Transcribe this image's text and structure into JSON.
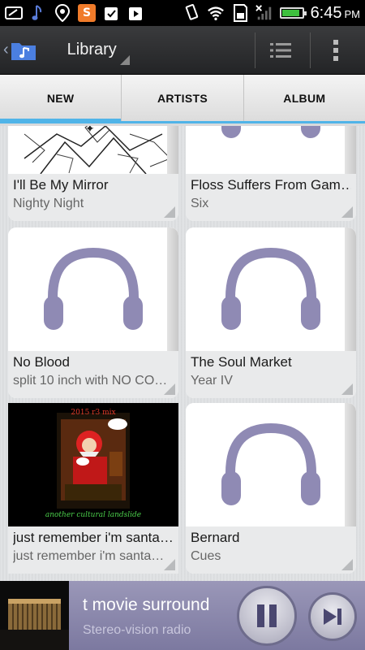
{
  "status_bar": {
    "time": "6:45",
    "ampm": "PM",
    "battery_level": 0.9,
    "left_icons": [
      "tablet-icon",
      "music-note-icon",
      "location-pin-icon",
      "s-app-icon",
      "clipboard-check-icon",
      "video-play-icon"
    ],
    "right_icons": [
      "vibrate-icon",
      "wifi-icon",
      "sd-card-icon",
      "no-signal-icon",
      "battery-icon"
    ]
  },
  "action_bar": {
    "title": "Library",
    "icons": [
      "back-chevron-icon",
      "music-folder-icon",
      "list-view-icon",
      "overflow-menu-icon"
    ]
  },
  "tabs": [
    {
      "label": "NEW",
      "active": true
    },
    {
      "label": "ARTISTS",
      "active": false
    },
    {
      "label": "ALBUM",
      "active": false
    }
  ],
  "albums": [
    {
      "title": "I'll Be My Mirror",
      "artist": "Nighty Night",
      "art": "sketch"
    },
    {
      "title": "Floss Suffers From Gam…",
      "artist": "Six",
      "art": "headphones"
    },
    {
      "title": "No Blood",
      "artist": "split 10 inch with NO CO…",
      "art": "headphones"
    },
    {
      "title": "The Soul Market",
      "artist": "Year IV",
      "art": "headphones"
    },
    {
      "title": "just remember i'm santa…",
      "artist": "just remember i'm santa…",
      "art": "santa",
      "art_text": "2015 r3 mix",
      "art_caption": "another cultural landslide"
    },
    {
      "title": "Bernard",
      "artist": "Cues",
      "art": "headphones"
    }
  ],
  "now_playing": {
    "title": "t movie surround",
    "subtitle": "Stereo-vision radio",
    "controls": [
      "pause-icon",
      "next-track-icon"
    ]
  },
  "colors": {
    "accent": "#50b4e8",
    "headphones": "#8f8ab4",
    "now_playing_bg": "#8a87ad"
  }
}
